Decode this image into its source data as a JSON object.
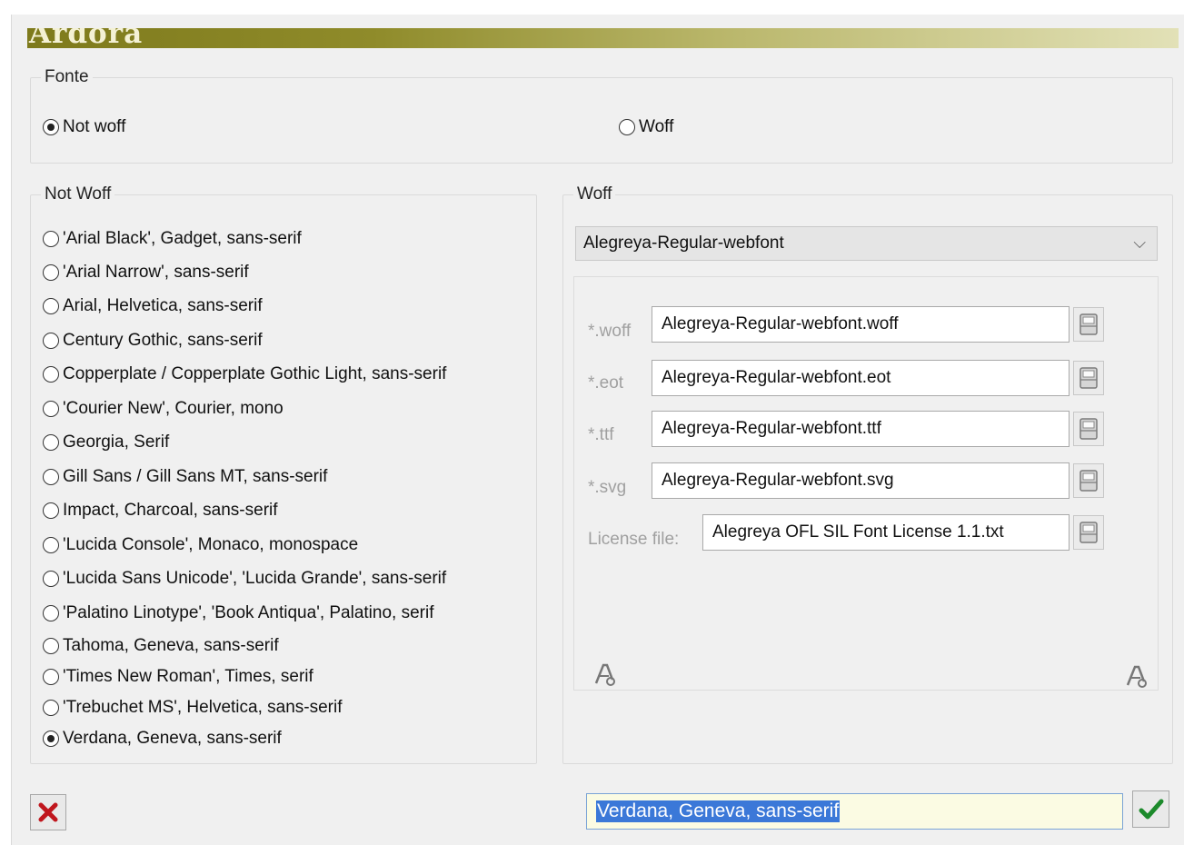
{
  "banner": {
    "title": "Ardora"
  },
  "fonte": {
    "legend": "Fonte",
    "options": [
      {
        "label": "Not woff",
        "checked": true
      },
      {
        "label": "Woff",
        "checked": false
      }
    ]
  },
  "not_woff": {
    "legend": "Not Woff",
    "fonts": [
      {
        "label": "'Arial Black', Gadget, sans-serif",
        "checked": false
      },
      {
        "label": "'Arial Narrow', sans-serif",
        "checked": false
      },
      {
        "label": "Arial, Helvetica, sans-serif",
        "checked": false
      },
      {
        "label": "Century Gothic, sans-serif",
        "checked": false
      },
      {
        "label": "Copperplate / Copperplate Gothic Light, sans-serif",
        "checked": false
      },
      {
        "label": "'Courier New', Courier, mono",
        "checked": false
      },
      {
        "label": "Georgia, Serif",
        "checked": false
      },
      {
        "label": "Gill Sans / Gill Sans MT, sans-serif",
        "checked": false
      },
      {
        "label": "Impact, Charcoal, sans-serif",
        "checked": false
      },
      {
        "label": "'Lucida Console', Monaco, monospace",
        "checked": false
      },
      {
        "label": "'Lucida Sans Unicode', 'Lucida Grande', sans-serif",
        "checked": false
      },
      {
        "label": "'Palatino Linotype', 'Book Antiqua', Palatino, serif",
        "checked": false
      },
      {
        "label": "Tahoma, Geneva, sans-serif",
        "checked": false
      },
      {
        "label": "'Times New Roman', Times, serif",
        "checked": false
      },
      {
        "label": "'Trebuchet MS', Helvetica, sans-serif",
        "checked": false
      },
      {
        "label": "Verdana, Geneva, sans-serif",
        "checked": true
      }
    ]
  },
  "woff": {
    "legend": "Woff",
    "selected_font": "Alegreya-Regular-webfont",
    "files": [
      {
        "label": "*.woff",
        "value": "Alegreya-Regular-webfont.woff"
      },
      {
        "label": "*.eot",
        "value": "Alegreya-Regular-webfont.eot"
      },
      {
        "label": "*.ttf",
        "value": "Alegreya-Regular-webfont.ttf"
      },
      {
        "label": "*.svg",
        "value": "Alegreya-Regular-webfont.svg"
      },
      {
        "label": "License file:",
        "value": "Alegreya OFL SIL Font License 1.1.txt"
      }
    ],
    "icons": [
      "file-open-icon",
      "font-preview-icon"
    ]
  },
  "footer": {
    "result_value": "Verdana, Geneva, sans-serif",
    "cancel_icon": "close-icon",
    "ok_icon": "checkmark-icon"
  },
  "colors": {
    "banner_dark": "#7e7a1c",
    "banner_light": "#e2e1b7",
    "cancel_red": "#c0161d",
    "ok_green": "#1c8a2b",
    "result_bg": "#fbfbe3",
    "selection_blue": "#3b78d8"
  }
}
